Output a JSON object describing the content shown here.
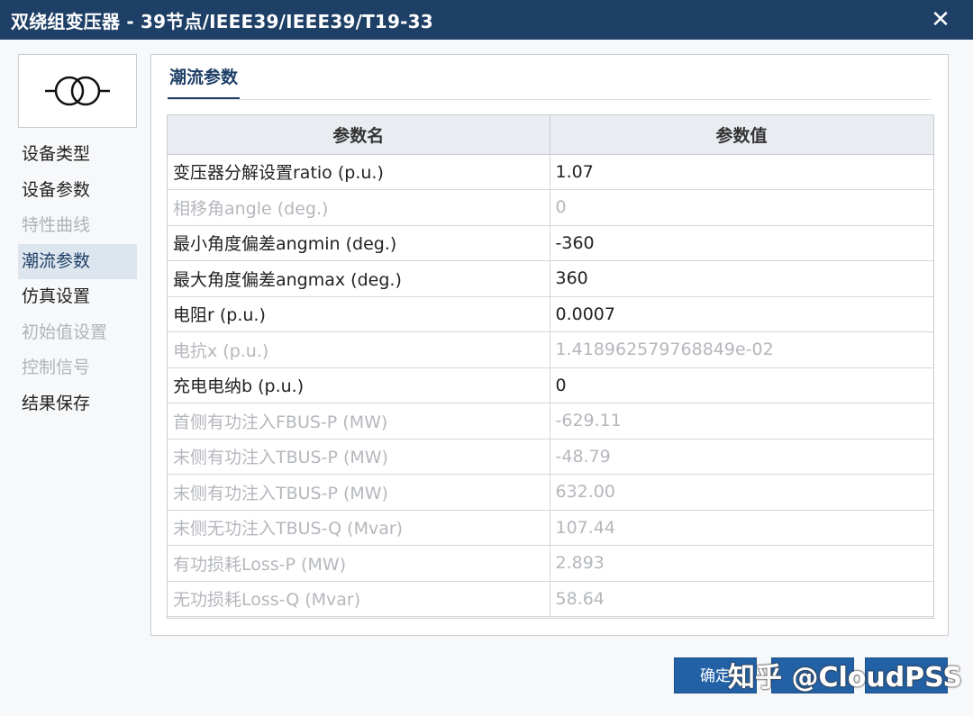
{
  "window": {
    "title": "双绕组变压器 - 39节点/IEEE39/IEEE39/T19-33",
    "close_label": "✕"
  },
  "device_icon": "transformer-two-winding-icon",
  "sidebar": {
    "items": [
      {
        "label": "设备类型",
        "state": "normal"
      },
      {
        "label": "设备参数",
        "state": "normal"
      },
      {
        "label": "特性曲线",
        "state": "disabled"
      },
      {
        "label": "潮流参数",
        "state": "active"
      },
      {
        "label": "仿真设置",
        "state": "normal"
      },
      {
        "label": "初始值设置",
        "state": "disabled"
      },
      {
        "label": "控制信号",
        "state": "disabled"
      },
      {
        "label": "结果保存",
        "state": "normal"
      }
    ]
  },
  "main": {
    "tab": "潮流参数",
    "table": {
      "headers": [
        "参数名",
        "参数值"
      ],
      "rows": [
        {
          "name": "变压器分解设置ratio (p.u.)",
          "value": "1.07",
          "editable": true
        },
        {
          "name": "相移角angle (deg.)",
          "value": "0",
          "editable": false
        },
        {
          "name": "最小角度偏差angmin (deg.)",
          "value": "-360",
          "editable": true
        },
        {
          "name": "最大角度偏差angmax (deg.)",
          "value": "360",
          "editable": true
        },
        {
          "name": "电阻r (p.u.)",
          "value": "0.0007",
          "editable": true
        },
        {
          "name": "电抗x (p.u.)",
          "value": "1.418962579768849e-02",
          "editable": false
        },
        {
          "name": "充电电纳b (p.u.)",
          "value": "0",
          "editable": true
        },
        {
          "name": "首侧有功注入FBUS-P (MW)",
          "value": "-629.11",
          "editable": false
        },
        {
          "name": "末侧有功注入TBUS-P (MW)",
          "value": "-48.79",
          "editable": false
        },
        {
          "name": "末侧有功注入TBUS-P (MW)",
          "value": "632.00",
          "editable": false
        },
        {
          "name": "末侧无功注入TBUS-Q (Mvar)",
          "value": "107.44",
          "editable": false
        },
        {
          "name": "有功损耗Loss-P (MW)",
          "value": "2.893",
          "editable": false
        },
        {
          "name": "无功损耗Loss-Q (Mvar)",
          "value": "58.64",
          "editable": false
        }
      ]
    }
  },
  "footer": {
    "ok_label": "确定",
    "mid_label": "",
    "cancel_label": ""
  },
  "watermark": "知乎 @CloudPSS",
  "colors": {
    "titlebar": "#1e3f66",
    "accent": "#1e3f66",
    "button": "#2361a6",
    "disabled_text": "#b4b7bc"
  }
}
